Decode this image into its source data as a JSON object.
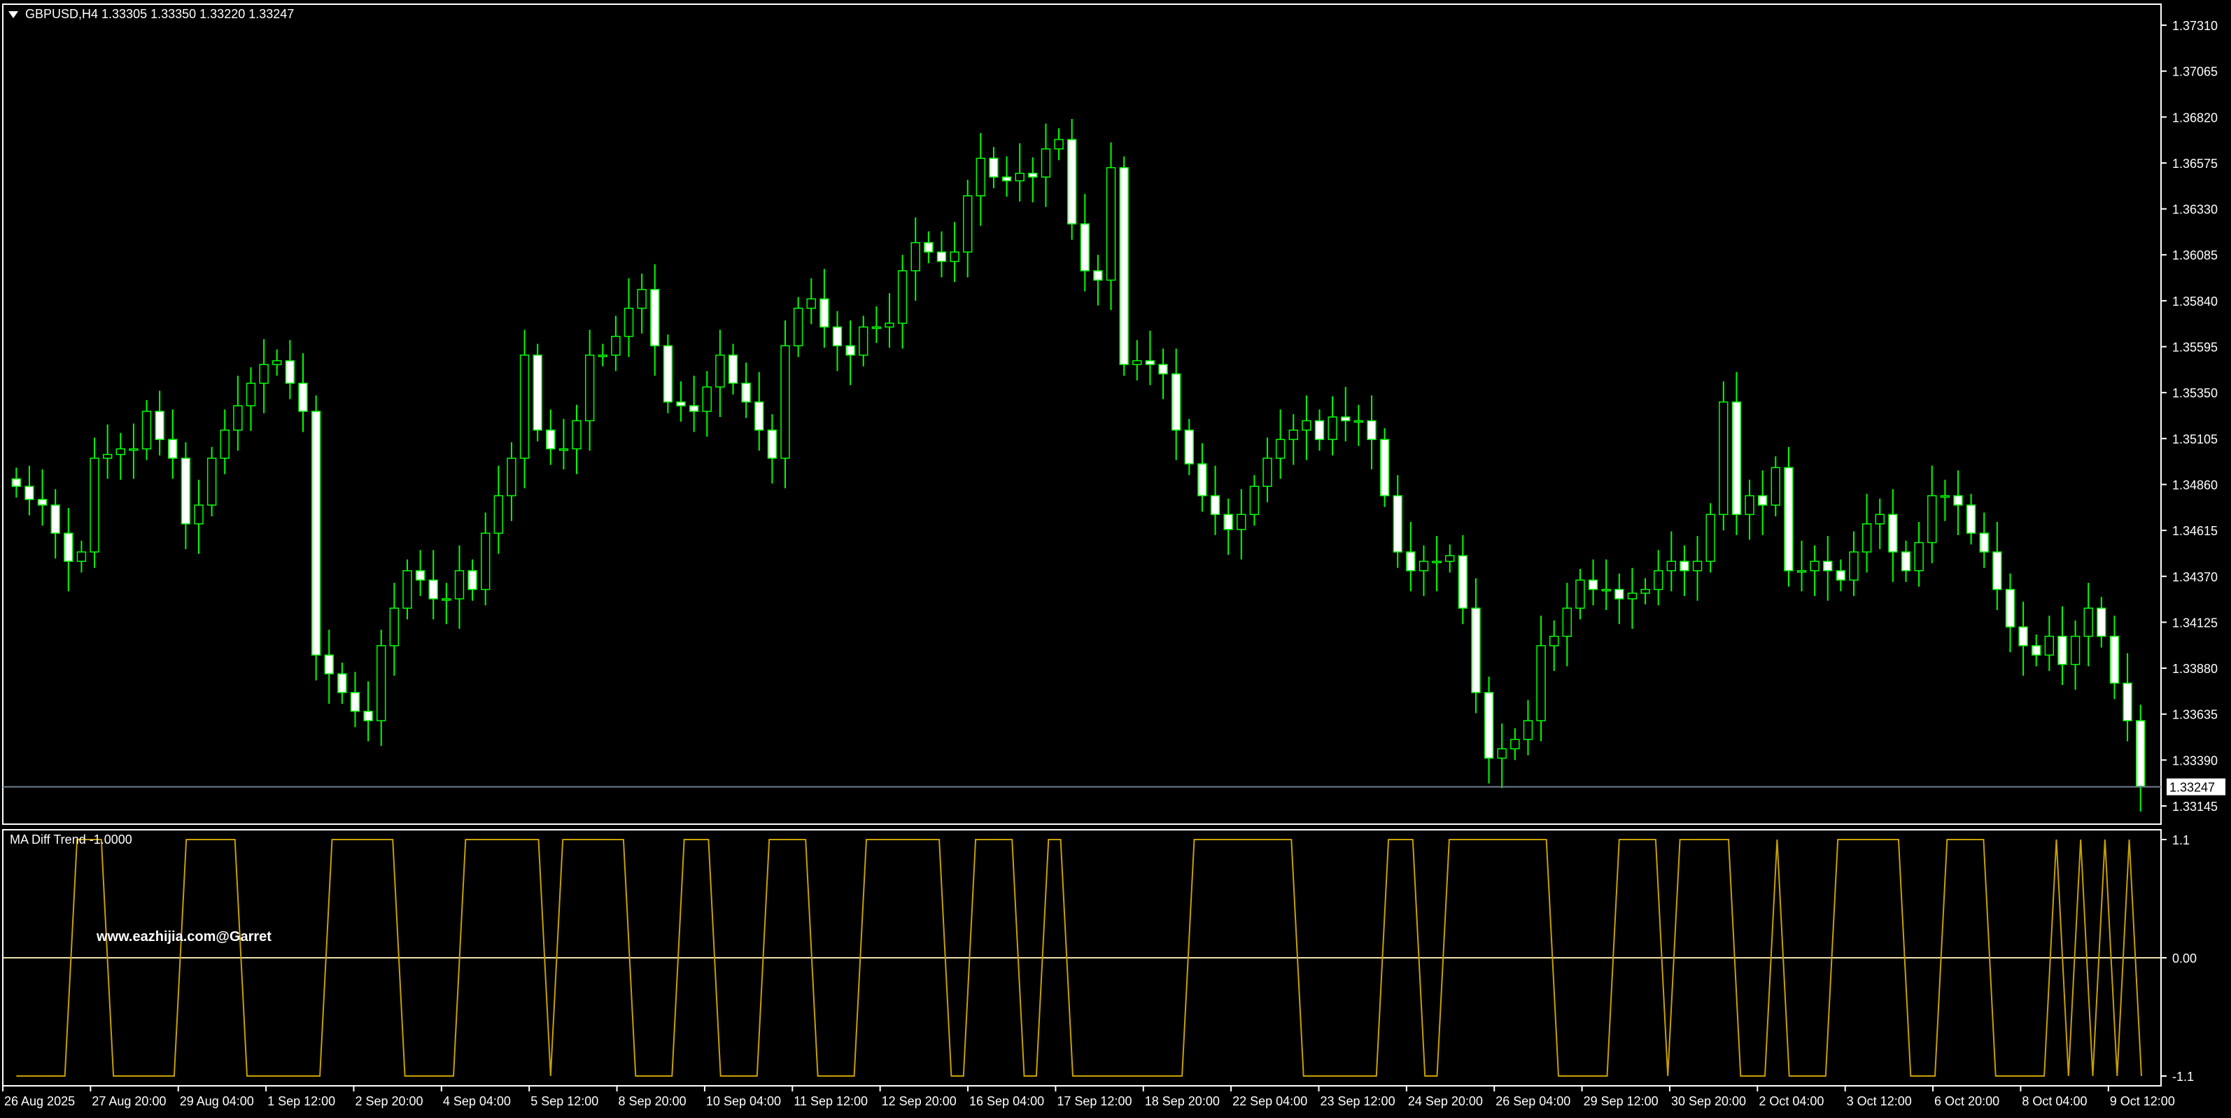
{
  "header": {
    "title": "GBPUSD,H4  1.33305 1.33350 1.33220 1.33247"
  },
  "indicator": {
    "label": "MA Diff Trend -1.0000",
    "watermark": "www.eazhijia.com@Garret"
  },
  "colors": {
    "background": "#000000",
    "candle": "#00ff00",
    "candle_body_up": "#000000",
    "candle_body_down": "#ffffff",
    "indicator_line": "#c8a000",
    "axis": "#ffffff",
    "price_line": "#708090"
  },
  "chart_data": [
    {
      "type": "candlestick",
      "title": "GBPUSD,H4",
      "ylim": [
        1.33145,
        1.3731
      ],
      "y_ticks": [
        "1.37310",
        "1.37065",
        "1.36820",
        "1.36575",
        "1.36330",
        "1.36085",
        "1.35840",
        "1.35595",
        "1.35350",
        "1.35105",
        "1.34860",
        "1.34615",
        "1.34370",
        "1.34125",
        "1.33880",
        "1.33635",
        "1.33390",
        "1.33145"
      ],
      "last_price": "1.33247",
      "x_ticks": [
        "26 Aug 2025",
        "27 Aug 20:00",
        "29 Aug 04:00",
        "1 Sep 12:00",
        "2 Sep 20:00",
        "4 Sep 04:00",
        "5 Sep 12:00",
        "8 Sep 20:00",
        "10 Sep 04:00",
        "11 Sep 12:00",
        "12 Sep 20:00",
        "16 Sep 04:00",
        "17 Sep 12:00",
        "18 Sep 20:00",
        "22 Sep 04:00",
        "23 Sep 12:00",
        "24 Sep 20:00",
        "26 Sep 04:00",
        "29 Sep 12:00",
        "30 Sep 20:00",
        "2 Oct 04:00",
        "3 Oct 12:00",
        "6 Oct 20:00",
        "8 Oct 04:00",
        "9 Oct 12:00"
      ],
      "closes": [
        1.3485,
        1.3478,
        1.3475,
        1.346,
        1.3445,
        1.345,
        1.35,
        1.3502,
        1.3505,
        1.3505,
        1.3525,
        1.351,
        1.35,
        1.3465,
        1.3475,
        1.35,
        1.3515,
        1.3528,
        1.354,
        1.355,
        1.3552,
        1.354,
        1.3525,
        1.3395,
        1.3385,
        1.3375,
        1.3365,
        1.336,
        1.34,
        1.342,
        1.344,
        1.3435,
        1.3425,
        1.3425,
        1.344,
        1.343,
        1.346,
        1.348,
        1.35,
        1.3555,
        1.3515,
        1.3505,
        1.3505,
        1.352,
        1.3555,
        1.3555,
        1.3565,
        1.358,
        1.359,
        1.356,
        1.353,
        1.3528,
        1.3525,
        1.3538,
        1.3555,
        1.354,
        1.353,
        1.3515,
        1.35,
        1.356,
        1.358,
        1.3585,
        1.357,
        1.356,
        1.3555,
        1.357,
        1.357,
        1.3572,
        1.36,
        1.3615,
        1.361,
        1.3605,
        1.361,
        1.364,
        1.366,
        1.365,
        1.3648,
        1.3652,
        1.365,
        1.3665,
        1.367,
        1.3625,
        1.36,
        1.3595,
        1.3655,
        1.355,
        1.3552,
        1.355,
        1.3545,
        1.3515,
        1.3497,
        1.348,
        1.347,
        1.3462,
        1.347,
        1.3485,
        1.35,
        1.351,
        1.3515,
        1.352,
        1.351,
        1.3522,
        1.352,
        1.352,
        1.351,
        1.348,
        1.345,
        1.344,
        1.3445,
        1.3445,
        1.3448,
        1.342,
        1.3375,
        1.334,
        1.3345,
        1.335,
        1.336,
        1.34,
        1.3405,
        1.342,
        1.3435,
        1.343,
        1.343,
        1.3425,
        1.3428,
        1.343,
        1.344,
        1.3445,
        1.344,
        1.3445,
        1.347,
        1.353,
        1.347,
        1.348,
        1.3475,
        1.3495,
        1.344,
        1.344,
        1.3445,
        1.344,
        1.3435,
        1.345,
        1.3465,
        1.347,
        1.345,
        1.344,
        1.3455,
        1.348,
        1.348,
        1.3475,
        1.346,
        1.345,
        1.343,
        1.341,
        1.34,
        1.3395,
        1.3405,
        1.339,
        1.3405,
        1.342,
        1.3405,
        1.338,
        1.336,
        1.3325
      ],
      "series": [
        {
          "name": "MA Diff Trend",
          "ylim": [
            -1.1,
            1.1
          ],
          "y_ticks": [
            "1.1",
            "0.00",
            "-1.1"
          ],
          "values": [
            -1.1,
            -1.1,
            -1.1,
            -1.1,
            -1.1,
            1.1,
            1.1,
            1.1,
            -1.1,
            -1.1,
            -1.1,
            -1.1,
            -1.1,
            -1.1,
            1.1,
            1.1,
            1.1,
            1.1,
            1.1,
            -1.1,
            -1.1,
            -1.1,
            -1.1,
            -1.1,
            -1.1,
            -1.1,
            1.1,
            1.1,
            1.1,
            1.1,
            1.1,
            1.1,
            -1.1,
            -1.1,
            -1.1,
            -1.1,
            -1.1,
            1.1,
            1.1,
            1.1,
            1.1,
            1.1,
            1.1,
            1.1,
            -1.1,
            1.1,
            1.1,
            1.1,
            1.1,
            1.1,
            1.1,
            -1.1,
            -1.1,
            -1.1,
            -1.1,
            1.1,
            1.1,
            1.1,
            -1.1,
            -1.1,
            -1.1,
            -1.1,
            1.1,
            1.1,
            1.1,
            1.1,
            -1.1,
            -1.1,
            -1.1,
            -1.1,
            1.1,
            1.1,
            1.1,
            1.1,
            1.1,
            1.1,
            1.1,
            -1.1,
            -1.1,
            1.1,
            1.1,
            1.1,
            1.1,
            -1.1,
            -1.1,
            1.1,
            1.1,
            -1.1,
            -1.1,
            -1.1,
            -1.1,
            -1.1,
            -1.1,
            -1.1,
            -1.1,
            -1.1,
            -1.1,
            1.1,
            1.1,
            1.1,
            1.1,
            1.1,
            1.1,
            1.1,
            1.1,
            1.1,
            -1.1,
            -1.1,
            -1.1,
            -1.1,
            -1.1,
            -1.1,
            -1.1,
            1.1,
            1.1,
            1.1,
            -1.1,
            -1.1,
            1.1,
            1.1,
            1.1,
            1.1,
            1.1,
            1.1,
            1.1,
            1.1,
            1.1,
            -1.1,
            -1.1,
            -1.1,
            -1.1,
            -1.1,
            1.1,
            1.1,
            1.1,
            1.1,
            -1.1,
            1.1,
            1.1,
            1.1,
            1.1,
            1.1,
            -1.1,
            -1.1,
            -1.1,
            1.1,
            -1.1,
            -1.1,
            -1.1,
            -1.1,
            1.1,
            1.1,
            1.1,
            1.1,
            1.1,
            1.1,
            -1.1,
            -1.1,
            -1.1,
            1.1,
            1.1,
            1.1,
            1.1,
            -1.1,
            -1.1,
            -1.1,
            -1.1,
            -1.1,
            1.1,
            -1.1,
            1.1,
            -1.1,
            1.1,
            -1.1,
            1.1,
            -1.1
          ]
        }
      ]
    }
  ]
}
